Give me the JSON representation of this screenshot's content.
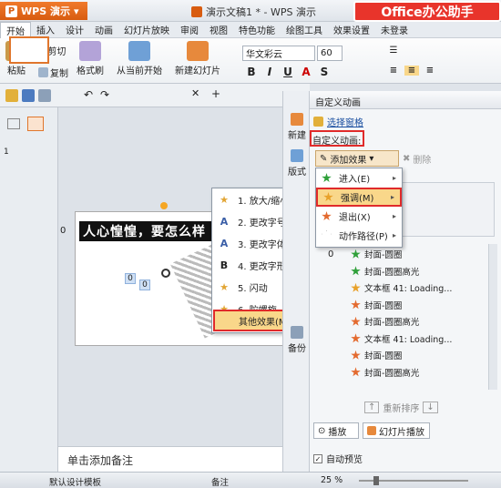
{
  "app": {
    "name": "WPS 演示",
    "doc_title": "演示文稿1 * - WPS 演示",
    "brand_badge": "Office办公助手"
  },
  "menu": {
    "tabs": [
      "开始",
      "插入",
      "设计",
      "动画",
      "幻灯片放映",
      "审阅",
      "视图",
      "特色功能",
      "绘图工具",
      "效果设置",
      "未登录"
    ]
  },
  "ribbon": {
    "paste": "粘贴",
    "cut": "剪切",
    "copy": "复制",
    "format_painter": "格式刷",
    "from_current": "从当前开始",
    "new_slide": "新建幻灯片",
    "font_name": "华文彩云",
    "font_size": "60"
  },
  "left_panel": {
    "slide_number": "1"
  },
  "slide": {
    "banner_text": "人心惶惶，要怎么样",
    "badge_0": "0",
    "badge_0b": "0",
    "badge_0c": "0",
    "badge_left": "0"
  },
  "notes_placeholder": "单击添加备注",
  "vstrip": {
    "new": "新建",
    "layout": "版式",
    "backup": "备份"
  },
  "pane": {
    "title": "自定义动画",
    "select_window": "选择窗格",
    "custom_anim_label": "自定义动画:",
    "add_effect": "添加效果",
    "delete": "删除",
    "reorder": "重新排序",
    "play": "播放",
    "slideshow": "幻灯片播放",
    "autopreview": "自动预览",
    "list_index": "0",
    "items": [
      {
        "icon": "enter",
        "label": "封面-圆圈"
      },
      {
        "icon": "enter",
        "label": "封面-圆圈高光"
      },
      {
        "icon": "emphasis",
        "label": "文本框 41: Loading..."
      },
      {
        "icon": "exit",
        "label": "封面-圆圈"
      },
      {
        "icon": "exit",
        "label": "封面-圆圈高光"
      },
      {
        "icon": "exit",
        "label": "文本框 41: Loading..."
      },
      {
        "icon": "exit",
        "label": "封面-圆圈"
      },
      {
        "icon": "exit",
        "label": "封面-圆圈高光"
      }
    ]
  },
  "add_effect_menu": [
    {
      "label": "进入(E)"
    },
    {
      "label": "强调(M)"
    },
    {
      "label": "退出(X)"
    },
    {
      "label": "动作路径(P)"
    }
  ],
  "emphasis_menu": [
    {
      "label": "1. 放大/缩小",
      "icon": "★"
    },
    {
      "label": "2. 更改字号",
      "icon": "A"
    },
    {
      "label": "3. 更改字体",
      "icon": "A"
    },
    {
      "label": "4. 更改字形",
      "icon": "B"
    },
    {
      "label": "5. 闪动",
      "icon": "★"
    },
    {
      "label": "6. 陀螺旋",
      "icon": "★"
    },
    {
      "label": "其他效果(M)..."
    }
  ],
  "status": {
    "template": "默认设计模板",
    "notes": "备注",
    "zoom": "25 %"
  },
  "colors": {
    "accent": "#d85c10",
    "highlight": "#f9d78a",
    "red_box": "#e02a2a"
  }
}
